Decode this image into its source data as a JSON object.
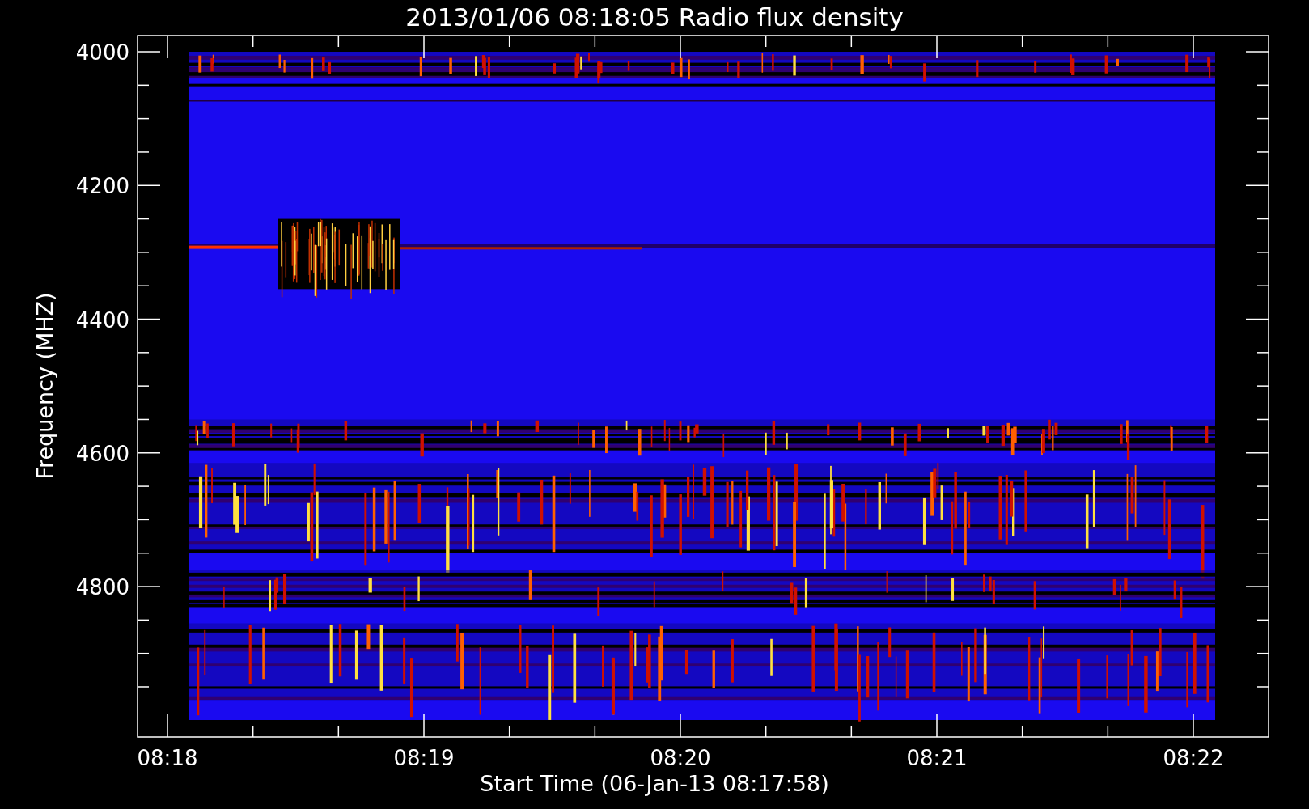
{
  "title": "2013/01/06 08:18:05 Radio flux density",
  "ylabel": "Frequency (MHZ)",
  "xlabel": "Start Time (06-Jan-13 08:17:58)",
  "y_ticks": [
    "4000",
    "4200",
    "4400",
    "4600",
    "4800"
  ],
  "x_ticks": [
    "08:18",
    "08:19",
    "08:20",
    "08:21",
    "08:22"
  ]
}
